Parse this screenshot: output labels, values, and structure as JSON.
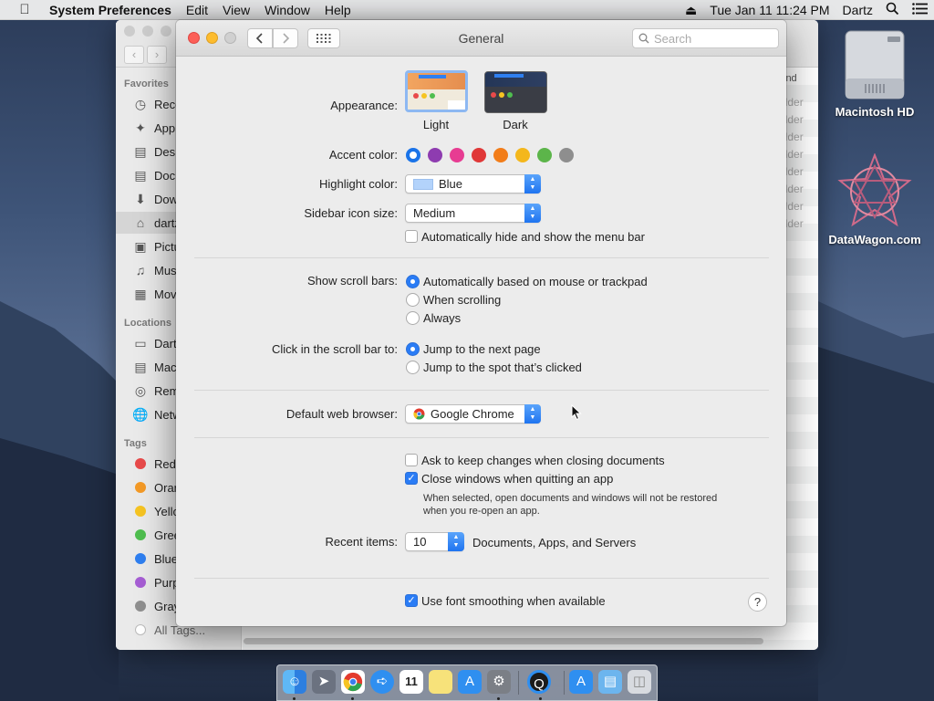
{
  "menubar": {
    "app_name": "System Preferences",
    "menus": [
      "Edit",
      "View",
      "Window",
      "Help"
    ],
    "clock": "Tue Jan 11  11:24 PM",
    "user": "Dartz"
  },
  "finder": {
    "favorites_header": "Favorites",
    "locations_header": "Locations",
    "tags_header": "Tags",
    "favorites": [
      "Rece",
      "App",
      "Desk",
      "Docu",
      "Dow",
      "dartz",
      "Pictu",
      "Musi",
      "Mov"
    ],
    "locations": [
      "Dart",
      "Mac",
      "Rem",
      "Netw"
    ],
    "tags": [
      "Red",
      "Oran",
      "Yello",
      "Gree",
      "Blue",
      "Purp",
      "Gray",
      "All Tags..."
    ],
    "kind_header": "ind",
    "kind_values": [
      "older",
      "older",
      "older",
      "older",
      "older",
      "older",
      "older",
      "older"
    ]
  },
  "desktop": {
    "hd_label": "Macintosh HD",
    "brand_label": "DataWagon.com"
  },
  "window": {
    "title": "General",
    "search_placeholder": "Search"
  },
  "general": {
    "appearance_label": "Appearance:",
    "appearance_options": [
      "Light",
      "Dark"
    ],
    "accent_label": "Accent color:",
    "accent_colors": [
      "#1a73e8",
      "#8e3cb0",
      "#e73c92",
      "#e03838",
      "#f27d19",
      "#f4b71c",
      "#5cb54a",
      "#8e8e8e"
    ],
    "highlight_label": "Highlight color:",
    "highlight_value": "Blue",
    "sidebar_icon_label": "Sidebar icon size:",
    "sidebar_icon_value": "Medium",
    "auto_hide_menu": "Automatically hide and show the menu bar",
    "scroll_bars_label": "Show scroll bars:",
    "scroll_bar_options": [
      "Automatically based on mouse or trackpad",
      "When scrolling",
      "Always"
    ],
    "click_scroll_label": "Click in the scroll bar to:",
    "click_scroll_options": [
      "Jump to the next page",
      "Jump to the spot that’s clicked"
    ],
    "browser_label": "Default web browser:",
    "browser_value": "Google Chrome",
    "ask_keep_changes": "Ask to keep changes when closing documents",
    "close_windows": "Close windows when quitting an app",
    "close_windows_note_1": "When selected, open documents and windows will not be restored",
    "close_windows_note_2": "when you re-open an app.",
    "recent_label": "Recent items:",
    "recent_value": "10",
    "recent_suffix": "Documents, Apps, and Servers",
    "font_smoothing": "Use font smoothing when available",
    "help": "?"
  },
  "dock": {
    "calendar_day": "11"
  }
}
